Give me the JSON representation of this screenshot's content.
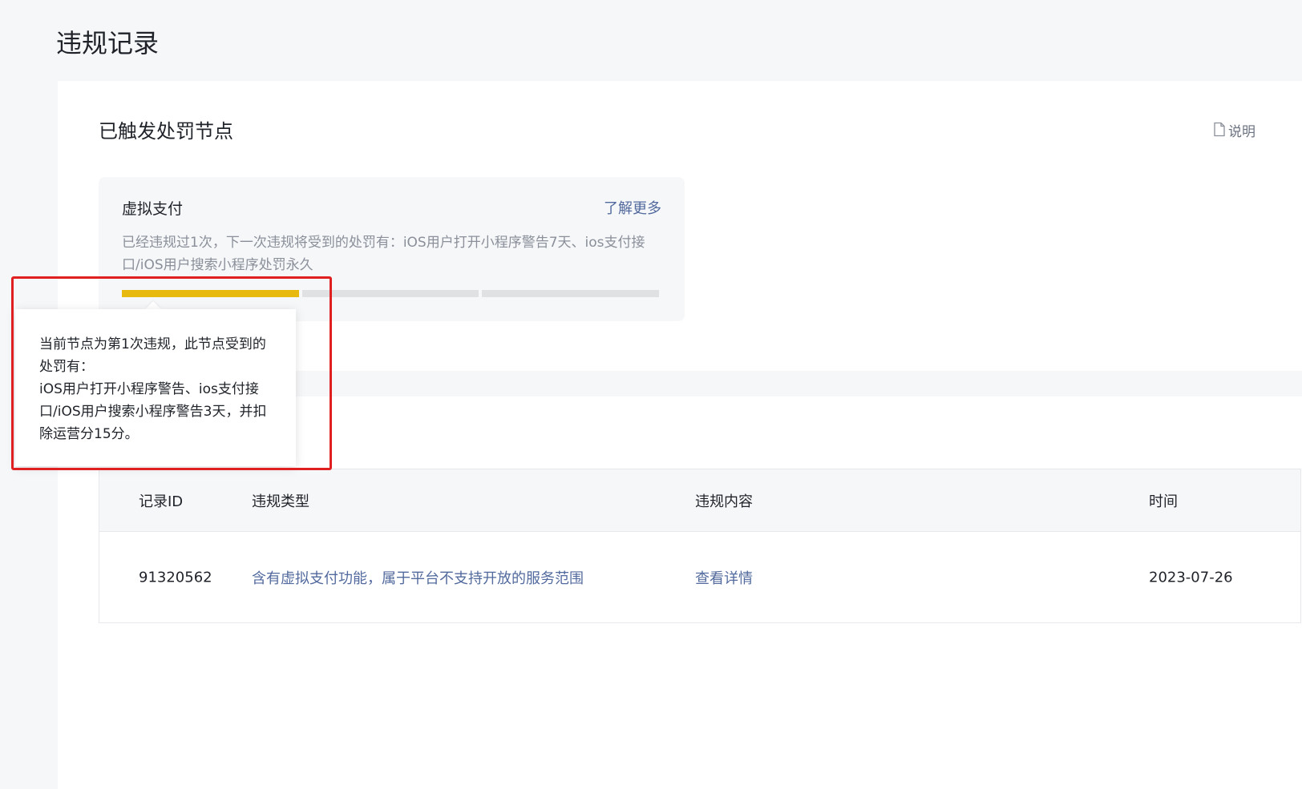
{
  "page": {
    "title": "违规记录"
  },
  "penalty_section": {
    "title": "已触发处罚节点",
    "explain_label": "说明",
    "explain_icon": "document-icon",
    "node": {
      "title": "虚拟支付",
      "learn_more": "了解更多",
      "description": "已经违规过1次，下一次违规将受到的处罚有：iOS用户打开小程序警告7天、ios支付接口/iOS用户搜索小程序处罚永久",
      "progress": {
        "total_segments": 3,
        "active_segments": 1,
        "active_color": "#e8b90f",
        "inactive_color": "#e0e1e3"
      }
    }
  },
  "tooltip": {
    "lines": [
      "当前节点为第1次违规，此节点受到的处罚有：",
      "iOS用户打开小程序警告、ios支付接口/iOS用户搜索小程序警告3天，并扣除运营分15分。"
    ],
    "highlight_color": "#e02020"
  },
  "table": {
    "headers": {
      "id": "记录ID",
      "type": "违规类型",
      "content": "违规内容",
      "time": "时间"
    },
    "rows": [
      {
        "id": "91320562",
        "type": "含有虚拟支付功能，属于平台不支持开放的服务范围",
        "content": "查看详情",
        "time": "2023-07-26"
      }
    ]
  },
  "colors": {
    "link": "#526a9d",
    "background": "#f6f7f9"
  }
}
